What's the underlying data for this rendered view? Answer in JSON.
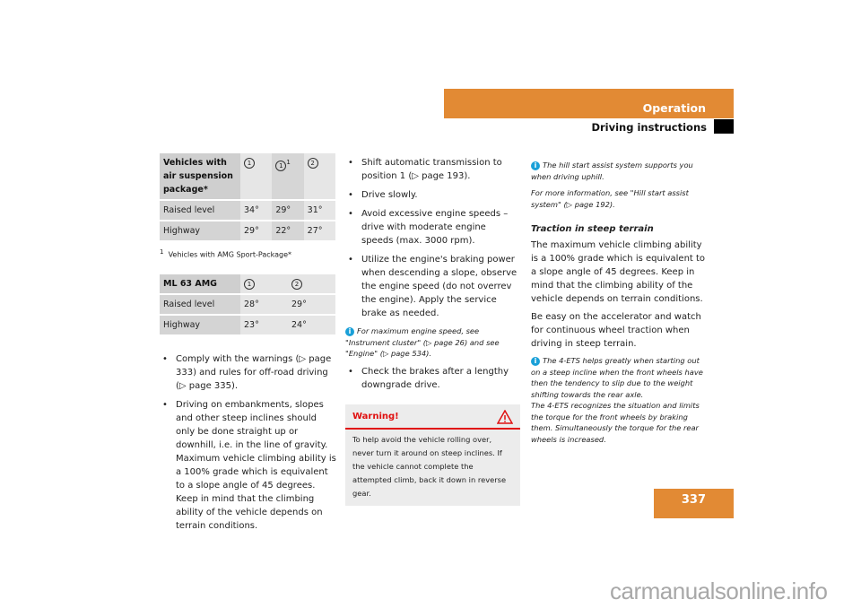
{
  "header": {
    "section": "Operation",
    "subsection": "Driving instructions"
  },
  "table1": {
    "header": [
      "Vehicles with air suspension package*",
      "①",
      "①",
      "②"
    ],
    "header_sup": "1",
    "rows": [
      [
        "Raised level",
        "34°",
        "29°",
        "31°"
      ],
      [
        "Highway",
        "29°",
        "22°",
        "27°"
      ]
    ],
    "footnote_mark": "1",
    "footnote": "Vehicles with AMG Sport-Package*"
  },
  "table2": {
    "header": [
      "ML 63 AMG",
      "①",
      "②"
    ],
    "rows": [
      [
        "Raised level",
        "28°",
        "29°"
      ],
      [
        "Highway",
        "23°",
        "24°"
      ]
    ]
  },
  "col1_bullets": [
    "Comply with the warnings (▷ page 333) and rules for off-road driving (▷ page 335).",
    "Driving on embankments, slopes and other steep inclines should only be done straight up or downhill, i.e. in the line of gravity. Maximum vehicle climbing ability is a 100% grade which is equivalent to a slope angle of 45 degrees. Keep in mind that the climbing ability of the vehicle depends on terrain conditions."
  ],
  "col2_bullets": [
    "Shift automatic transmission to position 1 (▷ page 193).",
    "Drive slowly.",
    "Avoid excessive engine speeds – drive with moderate engine speeds (max. 3000 rpm).",
    "Utilize the engine's braking power when descending a slope, observe the engine speed (do not overrev the engine). Apply the service brake as needed."
  ],
  "col2_note": "For maximum engine speed, see \"Instrument cluster\" (▷ page 26) and see \"Engine\" (▷ page 534).",
  "col2_bullets2": [
    "Check the brakes after a lengthy downgrade drive."
  ],
  "warning": {
    "title": "Warning!",
    "icon": "warning-triangle-icon",
    "body": "To help avoid the vehicle rolling over, never turn it around on steep inclines. If the vehicle cannot complete the attempted climb, back it down in reverse gear."
  },
  "col3": {
    "note1": "The hill start assist system supports you when driving uphill.",
    "note1b": "For more information, see \"Hill start assist system\" (▷ page 192).",
    "heading": "Traction in steep terrain",
    "para1": "The maximum vehicle climbing ability is a 100% grade which is equivalent to a slope angle of 45 degrees. Keep in mind that the climbing ability of the vehicle depends on terrain conditions.",
    "para2": "Be easy on the accelerator and watch for continuous wheel traction when driving in steep terrain.",
    "note2a": "The 4-ETS helps greatly when starting out on a steep incline when the front wheels have then the tendency to slip due to the weight shifting towards the rear axle.",
    "note2b": "The 4-ETS recognizes the situation and limits the torque for the front wheels by braking them. Simultaneously the torque for the rear wheels is increased."
  },
  "page_number": "337",
  "watermark": "carmanualsonline.info",
  "colors": {
    "accent": "#e28a34",
    "warning": "#e01010",
    "info": "#1aa0d8"
  }
}
